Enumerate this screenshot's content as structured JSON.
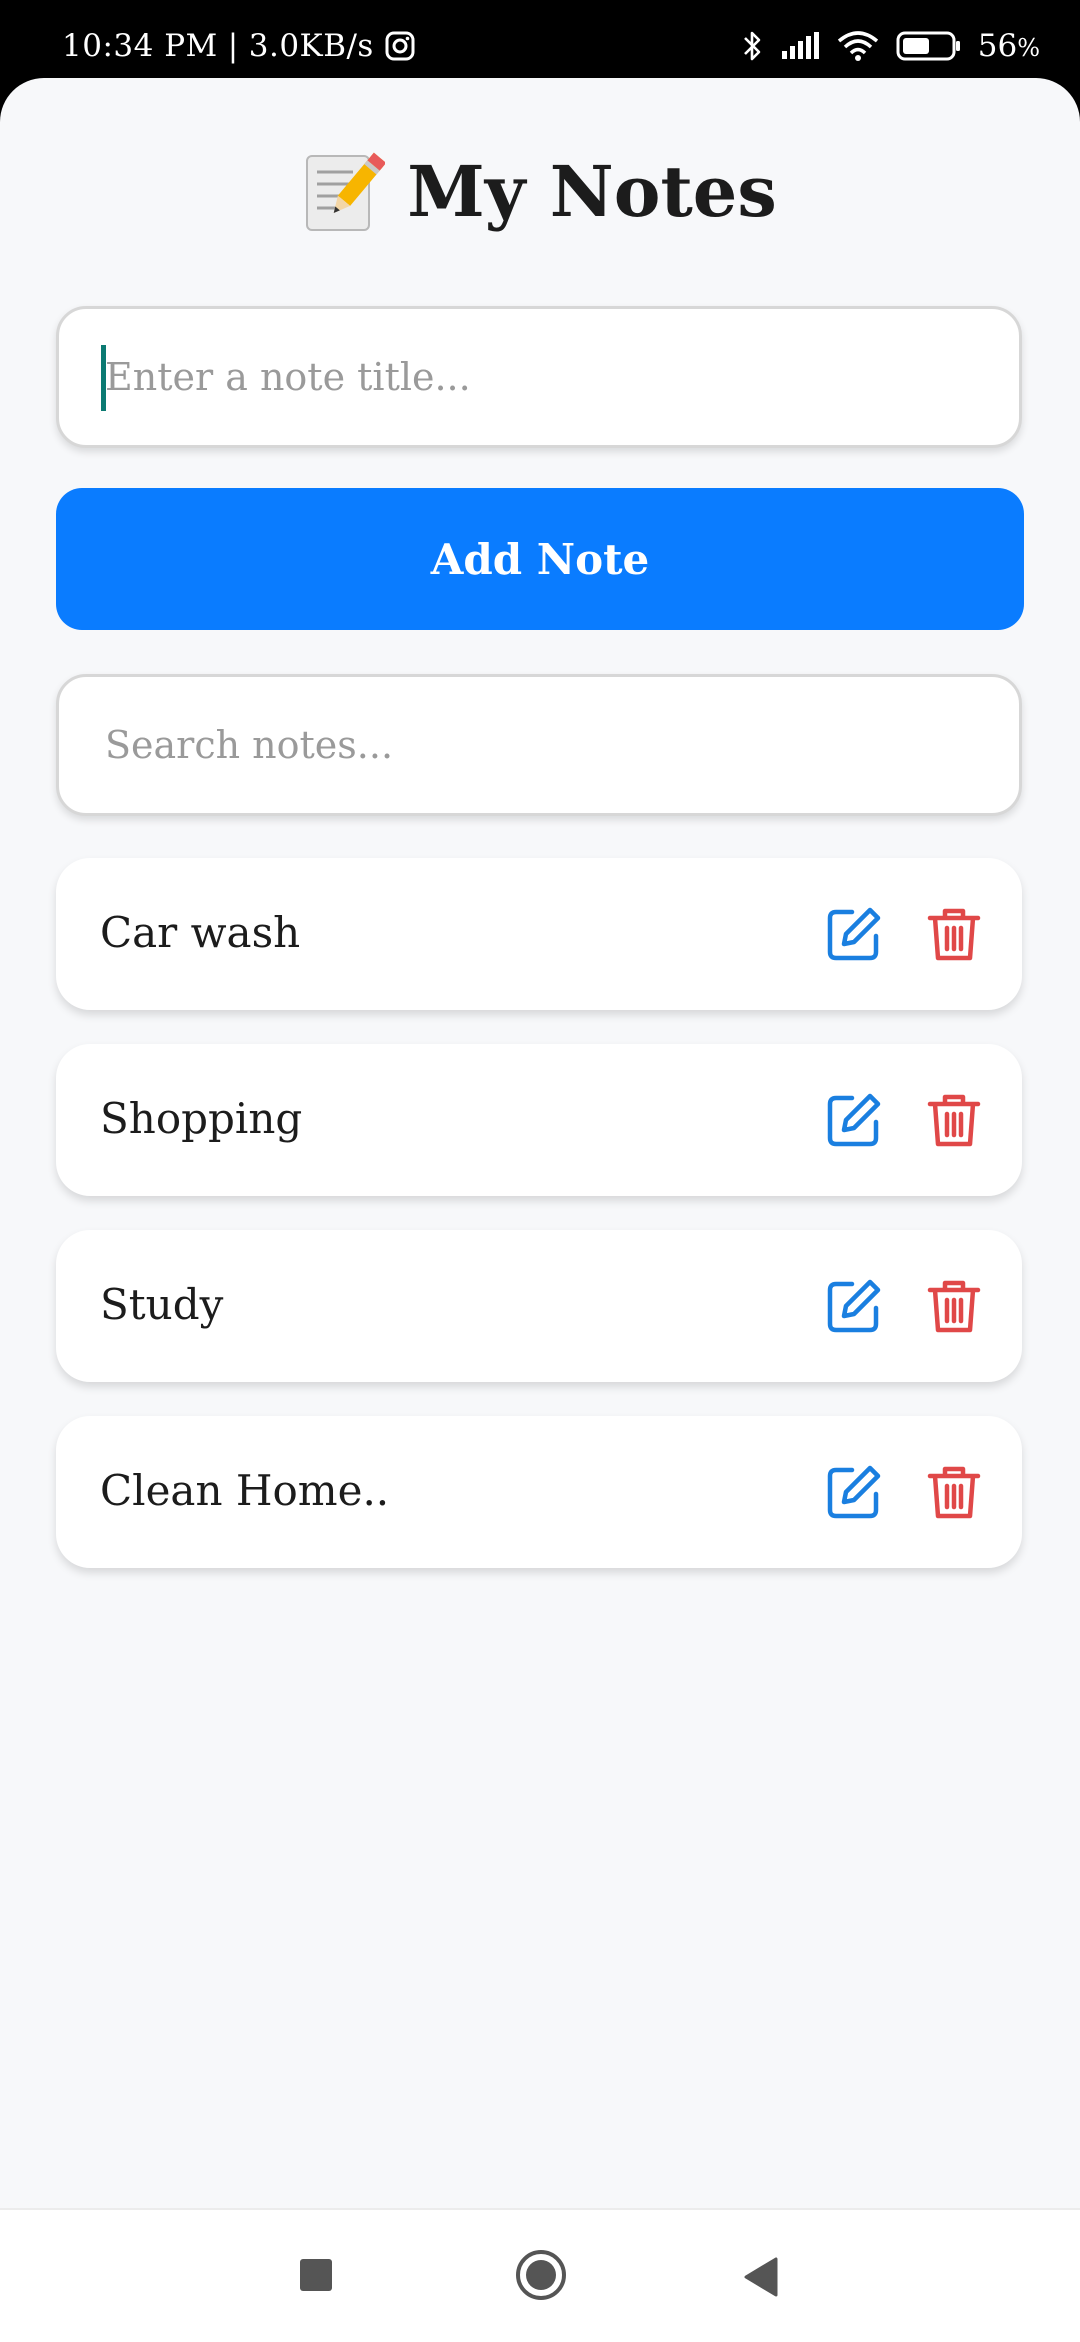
{
  "status_bar": {
    "time": "10:34 PM",
    "network_speed": "3.0KB/s",
    "battery_percent": "56",
    "battery_suffix": "%",
    "icons": [
      "instagram-icon",
      "bluetooth-icon",
      "signal-icon",
      "wifi-icon",
      "battery-icon"
    ]
  },
  "header": {
    "emoji": "memo-pencil-icon",
    "title": "My Notes"
  },
  "note_input": {
    "placeholder": "Enter a note title...",
    "value": ""
  },
  "add_button": {
    "label": "Add Note",
    "color": "#0a7cff"
  },
  "search": {
    "placeholder": "Search notes...",
    "value": ""
  },
  "notes": [
    {
      "title": "Car wash"
    },
    {
      "title": "Shopping"
    },
    {
      "title": "Study"
    },
    {
      "title": "Clean Home.."
    }
  ],
  "colors": {
    "edit_icon": "#1a7fe0",
    "delete_icon": "#e04848",
    "background": "#f7f8fa"
  },
  "nav": {
    "icons": [
      "recents-square-icon",
      "home-circle-icon",
      "back-triangle-icon"
    ]
  }
}
